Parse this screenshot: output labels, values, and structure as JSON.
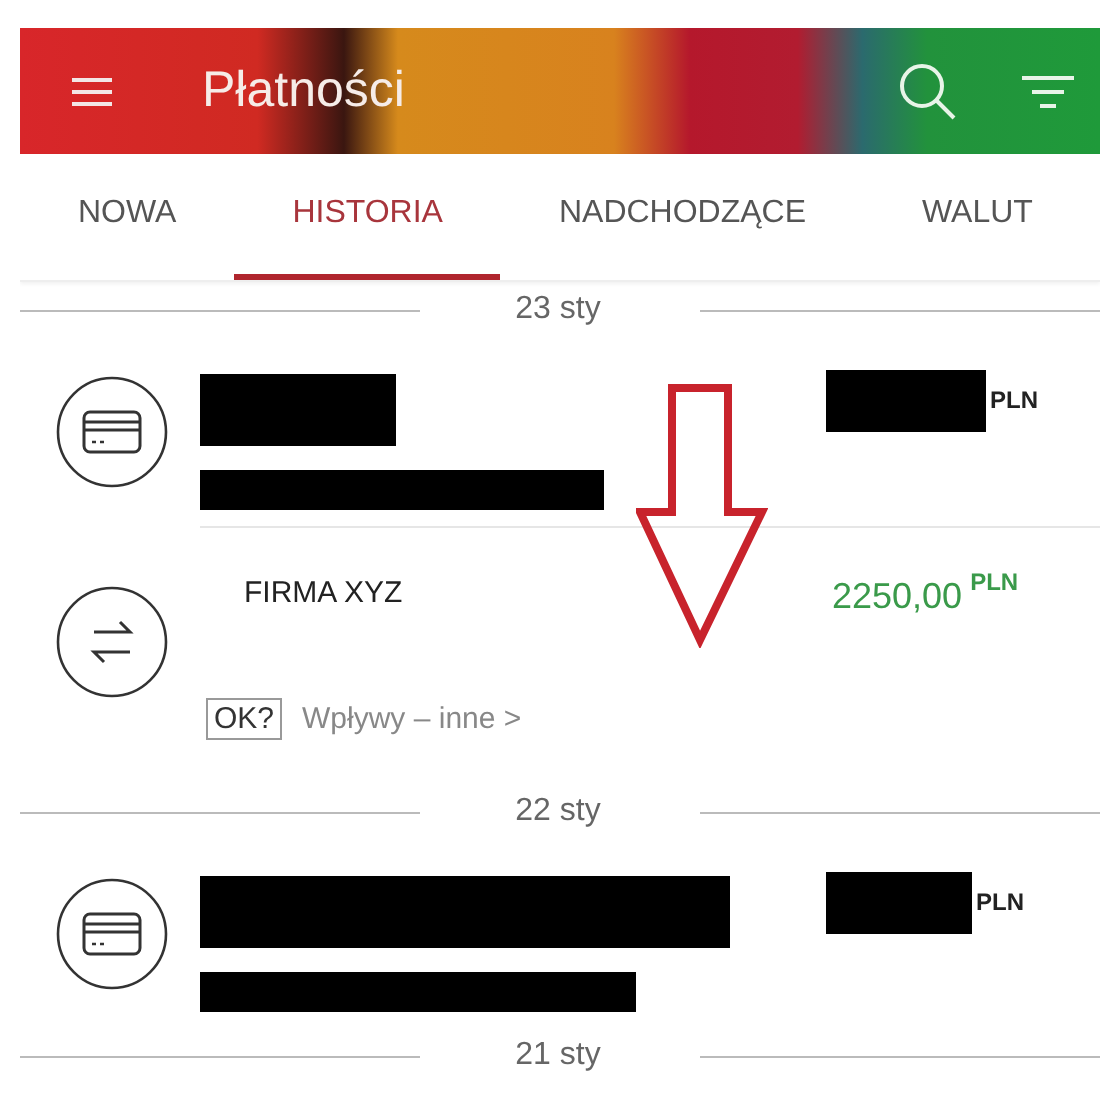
{
  "app_bar": {
    "title": "Płatności"
  },
  "tabs": [
    {
      "label": "NOWA",
      "selected": false
    },
    {
      "label": "HISTORIA",
      "selected": true
    },
    {
      "label": "NADCHODZĄCE",
      "selected": false
    },
    {
      "label": "WALUT",
      "selected": false
    }
  ],
  "groups": [
    {
      "date": "23 sty",
      "transactions": [
        {
          "kind": "redacted",
          "currency": "PLN",
          "incoming": false
        },
        {
          "kind": "named",
          "name": "FIRMA XYZ",
          "amount": "2250,00",
          "currency": "PLN",
          "incoming": true,
          "tag": "OK?",
          "category": "Wpływy – inne >"
        }
      ]
    },
    {
      "date": "22 sty",
      "transactions": [
        {
          "kind": "redacted",
          "currency": "PLN",
          "incoming": false
        }
      ]
    },
    {
      "date": "21 sty"
    }
  ],
  "annotation": {
    "kind": "arrow-down"
  }
}
